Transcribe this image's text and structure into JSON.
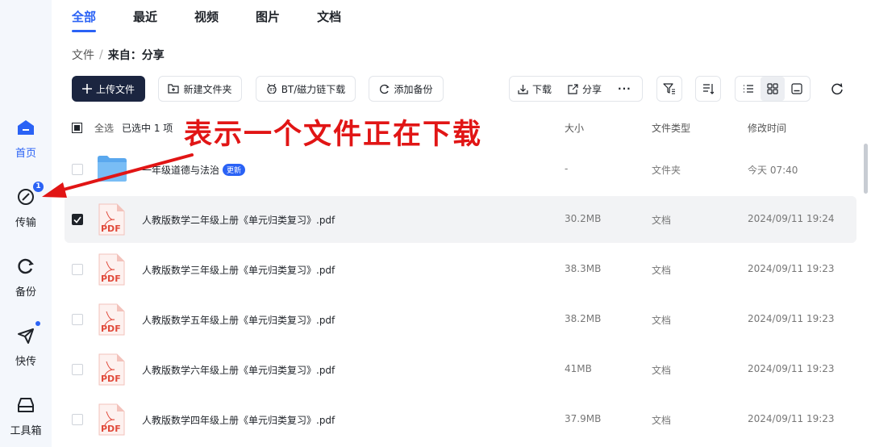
{
  "sidebar": {
    "items": [
      {
        "label": "首页",
        "icon": "home-icon",
        "active": true
      },
      {
        "label": "传输",
        "icon": "transfer-icon",
        "badge": "1"
      },
      {
        "label": "备份",
        "icon": "backup-icon"
      },
      {
        "label": "快传",
        "icon": "send-icon",
        "dot": true
      },
      {
        "label": "工具箱",
        "icon": "toolbox-icon"
      }
    ]
  },
  "tabs": [
    "全部",
    "最近",
    "视频",
    "图片",
    "文档"
  ],
  "breadcrumb": {
    "root": "文件",
    "separator": "/",
    "current": "来自：分享"
  },
  "toolbar": {
    "upload": "上传文件",
    "new_folder": "新建文件夹",
    "bt": "BT/磁力链下载",
    "add_backup": "添加备份",
    "download": "下载",
    "share": "分享",
    "more": "···"
  },
  "list_header": {
    "select_all": "全选",
    "selected_count": "已选中  1  项",
    "size": "大小",
    "type": "文件类型",
    "modified": "修改时间"
  },
  "files": [
    {
      "name": "一年级道德与法治",
      "size": "-",
      "type": "文件夹",
      "time": "今天 07:40",
      "kind": "folder",
      "badge": "更新",
      "checked": false
    },
    {
      "name": "人教版数学二年级上册《单元归类复习》.pdf",
      "size": "30.2MB",
      "type": "文档",
      "time": "2024/09/11 19:24",
      "kind": "pdf",
      "checked": true
    },
    {
      "name": "人教版数学三年级上册《单元归类复习》.pdf",
      "size": "38.3MB",
      "type": "文档",
      "time": "2024/09/11 19:23",
      "kind": "pdf",
      "checked": false
    },
    {
      "name": "人教版数学五年级上册《单元归类复习》.pdf",
      "size": "38.2MB",
      "type": "文档",
      "time": "2024/09/11 19:23",
      "kind": "pdf",
      "checked": false
    },
    {
      "name": "人教版数学六年级上册《单元归类复习》.pdf",
      "size": "41MB",
      "type": "文档",
      "time": "2024/09/11 19:23",
      "kind": "pdf",
      "checked": false
    },
    {
      "name": "人教版数学四年级上册《单元归类复习》.pdf",
      "size": "37.9MB",
      "type": "文档",
      "time": "2024/09/11 19:23",
      "kind": "pdf",
      "checked": false
    }
  ],
  "pdf_label": "PDF",
  "annotation": "表示一个文件正在下载",
  "colors": {
    "accent": "#2a62f5",
    "primary_button": "#1b2540",
    "annotation": "#e11515",
    "pdf_red": "#e0493a",
    "folder": "#5aa8ee"
  }
}
